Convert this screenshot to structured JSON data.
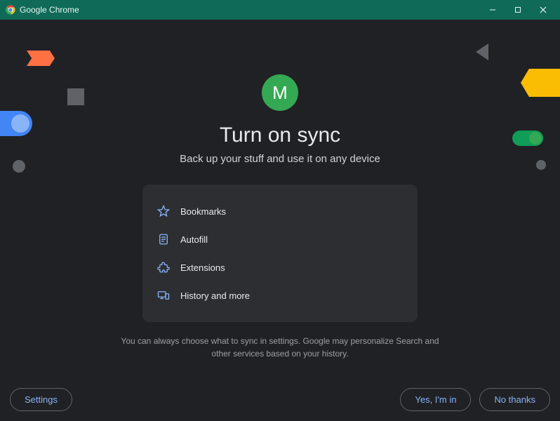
{
  "window": {
    "title": "Google Chrome"
  },
  "avatar": {
    "initial": "M"
  },
  "heading": "Turn on sync",
  "subtitle": "Back up your stuff and use it on any device",
  "sync_items": {
    "bookmarks": "Bookmarks",
    "autofill": "Autofill",
    "extensions": "Extensions",
    "history": "History and more"
  },
  "fineprint": "You can always choose what to sync in settings. Google may personalize Search and other services based on your history.",
  "buttons": {
    "settings": "Settings",
    "accept": "Yes, I'm in",
    "decline": "No thanks"
  }
}
